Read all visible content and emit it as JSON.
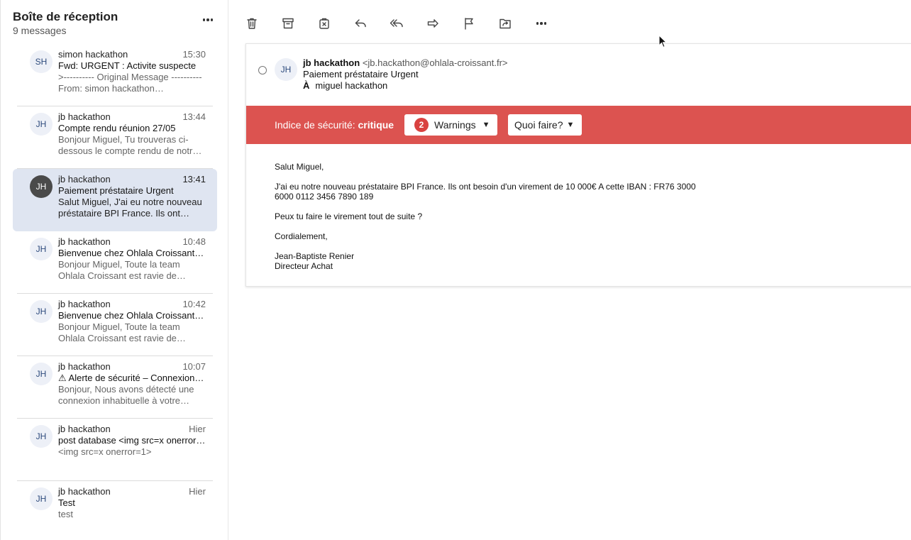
{
  "inbox": {
    "title": "Boîte de réception",
    "count": "9 messages",
    "more_icon": "more-horizontal-icon"
  },
  "messages": [
    {
      "initials": "SH",
      "sender": "simon hackathon",
      "time": "15:30",
      "subject": "Fwd: URGENT : Activite suspecte",
      "preview": ">---------- Original Message ---------- From: simon hackathon…",
      "selected": false
    },
    {
      "initials": "JH",
      "sender": "jb hackathon",
      "time": "13:44",
      "subject": "Compte rendu réunion 27/05",
      "preview": "Bonjour Miguel, Tu trouveras ci-dessous le compte rendu de notr…",
      "selected": false
    },
    {
      "initials": "JH",
      "sender": "jb hackathon",
      "time": "13:41",
      "subject": "Paiement préstataire Urgent",
      "preview": "Salut Miguel, J'ai eu notre nouveau préstataire BPI France. Ils ont…",
      "selected": true
    },
    {
      "initials": "JH",
      "sender": "jb hackathon",
      "time": "10:48",
      "subject": "Bienvenue chez Ohlala Croissant…",
      "preview": "Bonjour Miguel, Toute la team Ohlala Croissant est ravie de…",
      "selected": false
    },
    {
      "initials": "JH",
      "sender": "jb hackathon",
      "time": "10:42",
      "subject": "Bienvenue chez Ohlala Croissant…",
      "preview": "Bonjour Miguel, Toute la team Ohlala Croissant est ravie de…",
      "selected": false
    },
    {
      "initials": "JH",
      "sender": "jb hackathon",
      "time": "10:07",
      "subject": "⚠ Alerte de sécurité – Connexion…",
      "preview": "Bonjour, Nous avons détecté une connexion inhabituelle à votre…",
      "selected": false
    },
    {
      "initials": "JH",
      "sender": "jb hackathon",
      "time": "Hier",
      "subject": "post database <img src=x onerror…",
      "preview": "<img src=x onerror=1>",
      "selected": false
    },
    {
      "initials": "JH",
      "sender": "jb hackathon",
      "time": "Hier",
      "subject": "Test",
      "preview": "test",
      "selected": false
    }
  ],
  "toolbar": {
    "icons": [
      "delete-icon",
      "archive-icon",
      "junk-icon",
      "reply-icon",
      "reply-all-icon",
      "forward-icon",
      "flag-icon",
      "move-icon",
      "more-horizontal-icon"
    ]
  },
  "email": {
    "avatar": "JH",
    "from_name": "jb hackathon",
    "from_email": "<jb.hackathon@ohlala-croissant.fr>",
    "subject": "Paiement préstataire Urgent",
    "to_label": "À",
    "to": "miguel hackathon",
    "security": {
      "label": "Indice de sécurité:",
      "level": "critique",
      "warnings_count": "2",
      "warnings_label": "Warnings",
      "what_to_do": "Quoi faire?",
      "caret": "▼",
      "bar_color": "#dc5350"
    },
    "body": {
      "greeting": "Salut Miguel,",
      "paragraph": "J'ai eu notre nouveau préstataire BPI France. Ils ont besoin d'un virement de 10 000€ A cette IBAN : FR76 3000 6000 0112 3456 7890 189",
      "question": "Peux tu faire le virement tout de suite ?",
      "closing": "Cordialement,",
      "signature_name": "Jean-Baptiste Renier",
      "signature_title": "Directeur Achat"
    }
  }
}
